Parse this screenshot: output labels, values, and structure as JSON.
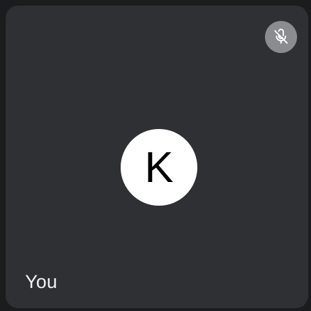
{
  "tile": {
    "avatar_initial": "K",
    "participant_name": "You",
    "mic_status_icon": "mic-off-icon",
    "colors": {
      "tile_background": "#2e3033",
      "avatar_background": "#ffffff",
      "mute_badge_background": "#8a8c90"
    }
  }
}
